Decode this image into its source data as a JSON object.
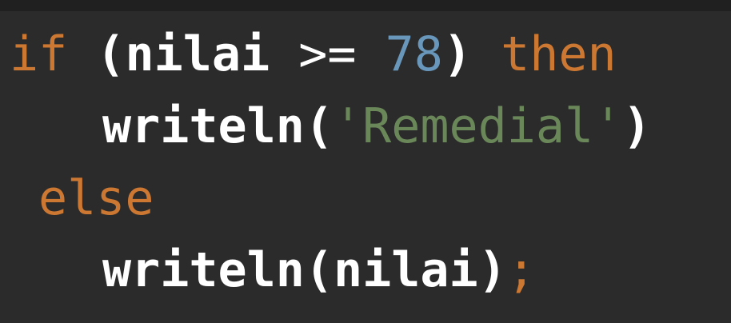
{
  "code": {
    "line1": {
      "kw_if": "if",
      "open_paren": "(",
      "var": "nilai",
      "op": ">=",
      "num": "78",
      "close_paren": ")",
      "kw_then": "then"
    },
    "line2": {
      "func": "writeln",
      "open_paren": "(",
      "string": "'Remedial'",
      "close_paren": ")"
    },
    "line3": {
      "kw_else": "else"
    },
    "line4": {
      "func": "writeln",
      "open_paren": "(",
      "arg": "nilai",
      "close_paren": ")",
      "semicolon": ";"
    }
  },
  "colors": {
    "background": "#2b2b2b",
    "keyword": "#cc7832",
    "identifier": "#ffffff",
    "number": "#6897bb",
    "string": "#6a8759"
  }
}
